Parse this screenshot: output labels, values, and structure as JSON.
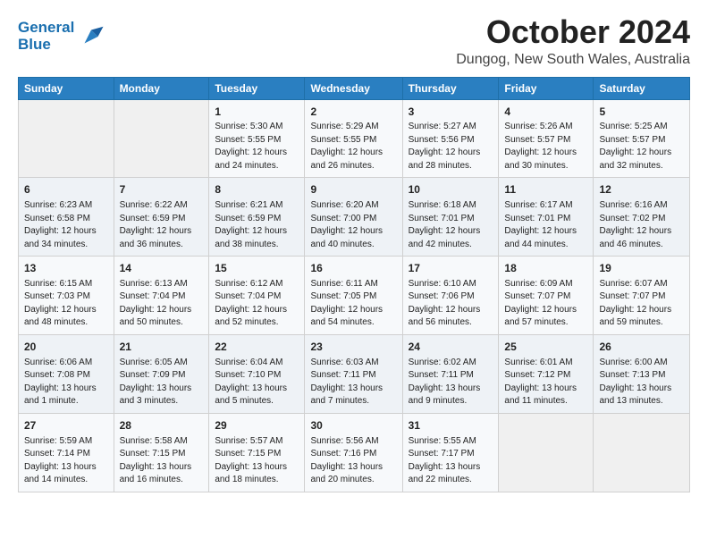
{
  "logo": {
    "line1": "General",
    "line2": "Blue"
  },
  "title": "October 2024",
  "subtitle": "Dungog, New South Wales, Australia",
  "weekdays": [
    "Sunday",
    "Monday",
    "Tuesday",
    "Wednesday",
    "Thursday",
    "Friday",
    "Saturday"
  ],
  "weeks": [
    [
      {
        "day": "",
        "empty": true
      },
      {
        "day": "",
        "empty": true
      },
      {
        "day": "1",
        "sunrise": "Sunrise: 5:30 AM",
        "sunset": "Sunset: 5:55 PM",
        "daylight": "Daylight: 12 hours and 24 minutes."
      },
      {
        "day": "2",
        "sunrise": "Sunrise: 5:29 AM",
        "sunset": "Sunset: 5:55 PM",
        "daylight": "Daylight: 12 hours and 26 minutes."
      },
      {
        "day": "3",
        "sunrise": "Sunrise: 5:27 AM",
        "sunset": "Sunset: 5:56 PM",
        "daylight": "Daylight: 12 hours and 28 minutes."
      },
      {
        "day": "4",
        "sunrise": "Sunrise: 5:26 AM",
        "sunset": "Sunset: 5:57 PM",
        "daylight": "Daylight: 12 hours and 30 minutes."
      },
      {
        "day": "5",
        "sunrise": "Sunrise: 5:25 AM",
        "sunset": "Sunset: 5:57 PM",
        "daylight": "Daylight: 12 hours and 32 minutes."
      }
    ],
    [
      {
        "day": "6",
        "sunrise": "Sunrise: 6:23 AM",
        "sunset": "Sunset: 6:58 PM",
        "daylight": "Daylight: 12 hours and 34 minutes."
      },
      {
        "day": "7",
        "sunrise": "Sunrise: 6:22 AM",
        "sunset": "Sunset: 6:59 PM",
        "daylight": "Daylight: 12 hours and 36 minutes."
      },
      {
        "day": "8",
        "sunrise": "Sunrise: 6:21 AM",
        "sunset": "Sunset: 6:59 PM",
        "daylight": "Daylight: 12 hours and 38 minutes."
      },
      {
        "day": "9",
        "sunrise": "Sunrise: 6:20 AM",
        "sunset": "Sunset: 7:00 PM",
        "daylight": "Daylight: 12 hours and 40 minutes."
      },
      {
        "day": "10",
        "sunrise": "Sunrise: 6:18 AM",
        "sunset": "Sunset: 7:01 PM",
        "daylight": "Daylight: 12 hours and 42 minutes."
      },
      {
        "day": "11",
        "sunrise": "Sunrise: 6:17 AM",
        "sunset": "Sunset: 7:01 PM",
        "daylight": "Daylight: 12 hours and 44 minutes."
      },
      {
        "day": "12",
        "sunrise": "Sunrise: 6:16 AM",
        "sunset": "Sunset: 7:02 PM",
        "daylight": "Daylight: 12 hours and 46 minutes."
      }
    ],
    [
      {
        "day": "13",
        "sunrise": "Sunrise: 6:15 AM",
        "sunset": "Sunset: 7:03 PM",
        "daylight": "Daylight: 12 hours and 48 minutes."
      },
      {
        "day": "14",
        "sunrise": "Sunrise: 6:13 AM",
        "sunset": "Sunset: 7:04 PM",
        "daylight": "Daylight: 12 hours and 50 minutes."
      },
      {
        "day": "15",
        "sunrise": "Sunrise: 6:12 AM",
        "sunset": "Sunset: 7:04 PM",
        "daylight": "Daylight: 12 hours and 52 minutes."
      },
      {
        "day": "16",
        "sunrise": "Sunrise: 6:11 AM",
        "sunset": "Sunset: 7:05 PM",
        "daylight": "Daylight: 12 hours and 54 minutes."
      },
      {
        "day": "17",
        "sunrise": "Sunrise: 6:10 AM",
        "sunset": "Sunset: 7:06 PM",
        "daylight": "Daylight: 12 hours and 56 minutes."
      },
      {
        "day": "18",
        "sunrise": "Sunrise: 6:09 AM",
        "sunset": "Sunset: 7:07 PM",
        "daylight": "Daylight: 12 hours and 57 minutes."
      },
      {
        "day": "19",
        "sunrise": "Sunrise: 6:07 AM",
        "sunset": "Sunset: 7:07 PM",
        "daylight": "Daylight: 12 hours and 59 minutes."
      }
    ],
    [
      {
        "day": "20",
        "sunrise": "Sunrise: 6:06 AM",
        "sunset": "Sunset: 7:08 PM",
        "daylight": "Daylight: 13 hours and 1 minute."
      },
      {
        "day": "21",
        "sunrise": "Sunrise: 6:05 AM",
        "sunset": "Sunset: 7:09 PM",
        "daylight": "Daylight: 13 hours and 3 minutes."
      },
      {
        "day": "22",
        "sunrise": "Sunrise: 6:04 AM",
        "sunset": "Sunset: 7:10 PM",
        "daylight": "Daylight: 13 hours and 5 minutes."
      },
      {
        "day": "23",
        "sunrise": "Sunrise: 6:03 AM",
        "sunset": "Sunset: 7:11 PM",
        "daylight": "Daylight: 13 hours and 7 minutes."
      },
      {
        "day": "24",
        "sunrise": "Sunrise: 6:02 AM",
        "sunset": "Sunset: 7:11 PM",
        "daylight": "Daylight: 13 hours and 9 minutes."
      },
      {
        "day": "25",
        "sunrise": "Sunrise: 6:01 AM",
        "sunset": "Sunset: 7:12 PM",
        "daylight": "Daylight: 13 hours and 11 minutes."
      },
      {
        "day": "26",
        "sunrise": "Sunrise: 6:00 AM",
        "sunset": "Sunset: 7:13 PM",
        "daylight": "Daylight: 13 hours and 13 minutes."
      }
    ],
    [
      {
        "day": "27",
        "sunrise": "Sunrise: 5:59 AM",
        "sunset": "Sunset: 7:14 PM",
        "daylight": "Daylight: 13 hours and 14 minutes."
      },
      {
        "day": "28",
        "sunrise": "Sunrise: 5:58 AM",
        "sunset": "Sunset: 7:15 PM",
        "daylight": "Daylight: 13 hours and 16 minutes."
      },
      {
        "day": "29",
        "sunrise": "Sunrise: 5:57 AM",
        "sunset": "Sunset: 7:15 PM",
        "daylight": "Daylight: 13 hours and 18 minutes."
      },
      {
        "day": "30",
        "sunrise": "Sunrise: 5:56 AM",
        "sunset": "Sunset: 7:16 PM",
        "daylight": "Daylight: 13 hours and 20 minutes."
      },
      {
        "day": "31",
        "sunrise": "Sunrise: 5:55 AM",
        "sunset": "Sunset: 7:17 PM",
        "daylight": "Daylight: 13 hours and 22 minutes."
      },
      {
        "day": "",
        "empty": true
      },
      {
        "day": "",
        "empty": true
      }
    ]
  ]
}
